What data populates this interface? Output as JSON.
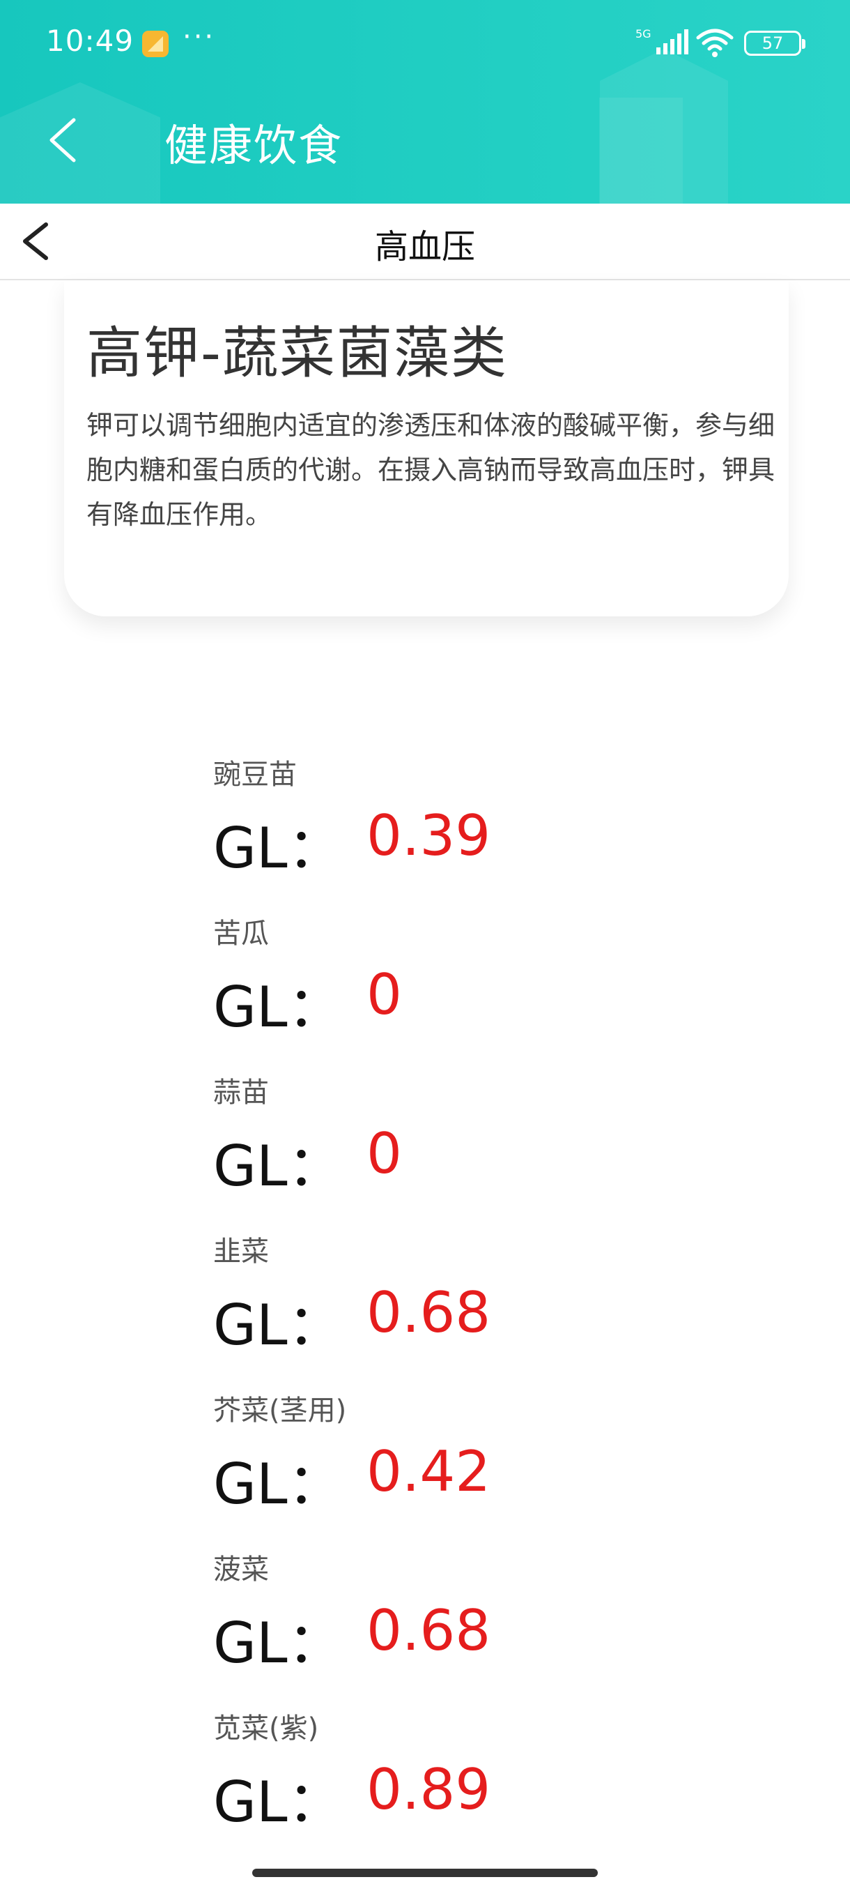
{
  "status_bar": {
    "time": "10:49",
    "more": "···",
    "network": "5G",
    "battery": "57"
  },
  "app_bar": {
    "title": "健康饮食",
    "back_icon": "chevron-left-icon"
  },
  "sub_header": {
    "title": "高血压",
    "back_icon": "chevron-left-icon"
  },
  "intro_card": {
    "title": "高钾-蔬菜菌藻类",
    "description": "钾可以调节细胞内适宜的渗透压和体液的酸碱平衡，参与细胞内糖和蛋白质的代谢。在摄入高钠而导致高血压时，钾具有降血压作用。"
  },
  "gl_label": "GL：",
  "foods": [
    {
      "name": "豌豆苗",
      "gl": "0.39"
    },
    {
      "name": "苦瓜",
      "gl": "0"
    },
    {
      "name": "蒜苗",
      "gl": "0"
    },
    {
      "name": "韭菜",
      "gl": "0.68"
    },
    {
      "name": "芥菜(茎用)",
      "gl": "0.42"
    },
    {
      "name": "菠菜",
      "gl": "0.68"
    },
    {
      "name": "苋菜(紫)",
      "gl": "0.89"
    }
  ],
  "colors": {
    "header_teal": "#1fccc1",
    "gl_value_red": "#e51d1d"
  }
}
